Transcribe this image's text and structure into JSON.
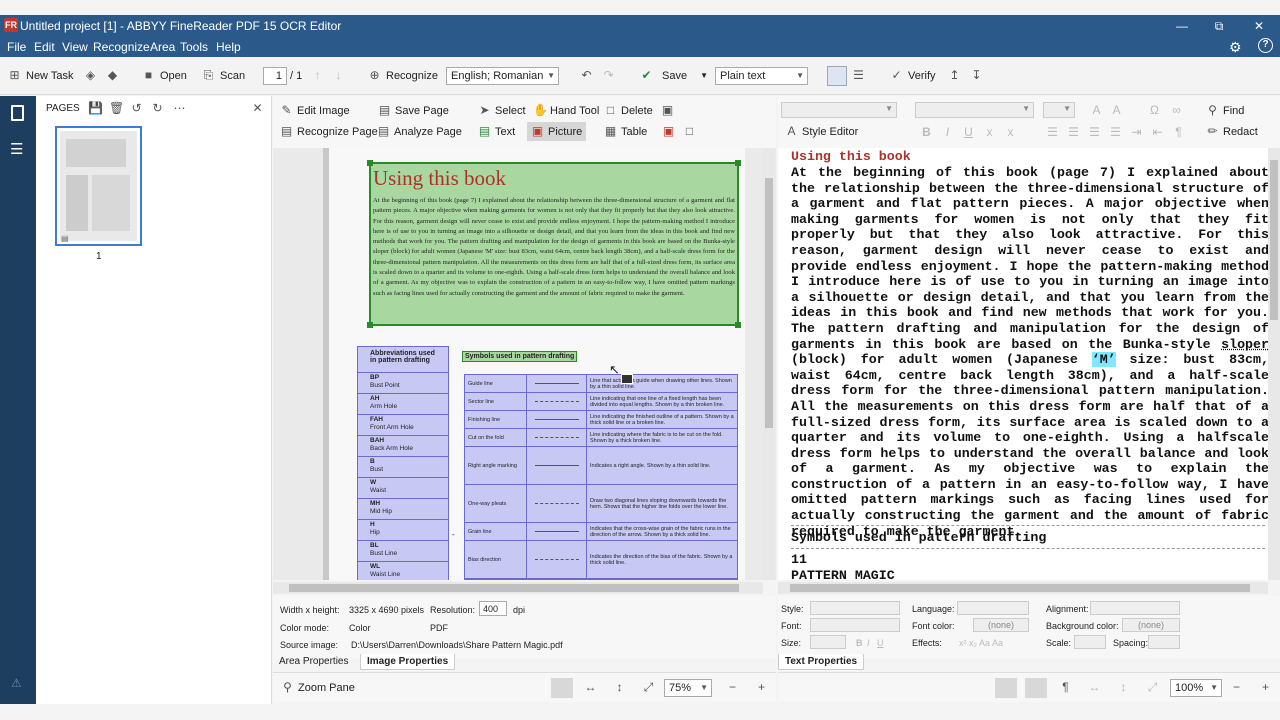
{
  "window": {
    "title": "Untitled project [1] - ABBYY FineReader PDF 15 OCR Editor",
    "app_icon": "FR"
  },
  "menu": [
    "File",
    "Edit",
    "View",
    "Recognize",
    "Area",
    "Tools",
    "Help"
  ],
  "toolbar": {
    "new_task": "New Task",
    "open": "Open",
    "scan": "Scan",
    "page_value": "1",
    "page_total": "/ 1",
    "recognize": "Recognize",
    "language": "English; Romanian",
    "save": "Save",
    "format": "Plain text",
    "verify": "Verify"
  },
  "pages_panel": {
    "title": "PAGES",
    "thumb_number": "1"
  },
  "image_tools": {
    "edit_image": "Edit Image",
    "save_page": "Save Page",
    "select": "Select",
    "hand_tool": "Hand Tool",
    "delete": "Delete",
    "recognize_page": "Recognize Page",
    "analyze_page": "Analyze Page",
    "text": "Text",
    "picture": "Picture",
    "table": "Table"
  },
  "document": {
    "heading": "Using this book",
    "body": "At the beginning of this book (page 7) I explained about the relationship between the three-dimensional structure of a garment and flat pattern pieces. A major objective when making garments for women is not only that they fit properly but that they also look attractive. For this reason, garment design will never cease to exist and provide endless enjoyment. I hope the pattern-making method I introduce here is of use to you in turning an image into a silhouette or design detail, and that you learn from the ideas in this book and find new methods that work for you. The pattern drafting and manipulation for the design of garments in this book are based on the Bunka-style sloper (block) for adult women (Japanese 'M' size: bust 83cm, waist 64cm, centre back length 38cm), and a half-scale dress form for the three-dimensional pattern manipulation. All the measurements on this dress form are half that of a full-sized dress form, its surface area is scaled down to a quarter and its volume to one-eighth. Using a half-scale dress form helps to understand the overall balance and look of a garment. As my objective was to explain the construction of a pattern in an easy-to-follow way, I have omitted pattern markings such as facing lines used for actually constructing the garment and the amount of fabric required to make the garment.",
    "abbr_title": "Abbreviations used in pattern drafting",
    "abbr": [
      {
        "code": "BP",
        "name": "Bust Point"
      },
      {
        "code": "AH",
        "name": "Arm Hole"
      },
      {
        "code": "FAH",
        "name": "Front Arm Hole"
      },
      {
        "code": "BAH",
        "name": "Back Arm Hole"
      },
      {
        "code": "B",
        "name": "Bust"
      },
      {
        "code": "W",
        "name": "Waist"
      },
      {
        "code": "MH",
        "name": "Mid Hip"
      },
      {
        "code": "H",
        "name": "Hip"
      },
      {
        "code": "BL",
        "name": "Bust Line"
      },
      {
        "code": "WL",
        "name": "Waist Line"
      }
    ],
    "sym_title": "Symbols used in pattern drafting",
    "symbols": [
      {
        "name": "Guide line",
        "desc": "Line that acts as a guide when drawing other lines. Shown by a thin solid line."
      },
      {
        "name": "Sector line",
        "desc": "Line indicating that one line of a fixed length has been divided into equal lengths. Shown by a thin broken line."
      },
      {
        "name": "Finishing line",
        "desc": "Line indicating the finished outline of a pattern. Shown by a thick solid line or a broken line."
      },
      {
        "name": "Cut on the fold",
        "desc": "Line indicating where the fabric is to be cut on the fold. Shown by a thick broken line."
      },
      {
        "name": "Right angle marking",
        "desc": "Indicates a right angle. Shown by a thin solid line."
      },
      {
        "name": "One-way pleats",
        "desc": "Draw two diagonal lines sloping downwards towards the hem. Shows that the higher line folds over the lower line."
      },
      {
        "name": "Grain line",
        "desc": "Indicates that the cross-wise grain of the fabric runs in the direction of the arrow. Shown by a thick solid line."
      },
      {
        "name": "Bias direction",
        "desc": "Indicates the direction of the bias of the fabric. Shown by a thick solid line."
      }
    ]
  },
  "image_props": {
    "wh_label": "Width x height:",
    "wh_value": "3325 x 4690 pixels",
    "res_label": "Resolution:",
    "res_value": "400",
    "res_unit": "dpi",
    "color_label": "Color mode:",
    "color_value": "Color",
    "format_value": "PDF",
    "source_label": "Source image:",
    "source_value": "D:\\Users\\Darren\\Downloads\\Share Pattern Magic.pdf"
  },
  "left_tabs": [
    "Area Properties",
    "Image Properties"
  ],
  "left_bottom": {
    "zoom_pane": "Zoom Pane",
    "zoom": "75%"
  },
  "right_tools": {
    "style_editor": "Style Editor",
    "find": "Find",
    "redact": "Redact"
  },
  "text_pane": {
    "heading": "Using this book",
    "para_before": "At the beginning of this book (page 7) I explained about the relationship between the three-dimensional structure of a garment and flat pattern pieces. A major objective when making garments for women is not only that they fit properly but that they also look attractive. For this reason, garment design will never cease to exist and provide endless enjoyment. I hope the pattern-making method I introduce here is of use to you in turning an image into a silhouette or design detail, and that you learn from the ideas in this book and find new methods that work for you. The pattern drafting and manipulation for the design of garments in this book are based on the Bunka-style ",
    "sloper": "sloper",
    "para_mid": " (block) for adult women (Japanese ",
    "highlight": "‘M’",
    "para_after": " size: bust 83cm, waist 64cm, centre back length 38cm), and a half-scale dress form for the three-dimensional pattern manipulation. All the measurements on this dress form are half that of a full-sized dress form, its surface area is scaled down to a quarter and its volume to one-eighth. Using a halfscale dress form helps to understand the overall balance and look of a garment. As my objective was to explain the construction of a pattern in an easy-to-follow way, I have omitted pattern markings such as facing lines used for actually constructing the garment and the amount of fabric required to make the garment.",
    "symbols_line": "Symbols used in pattern drafting",
    "page_num": "11",
    "footer": "PATTERN MAGIC"
  },
  "text_props": {
    "style": "Style:",
    "font": "Font:",
    "size": "Size:",
    "language": "Language:",
    "font_color": "Font color:",
    "effects": "Effects:",
    "font_color_value": "(none)",
    "alignment": "Alignment:",
    "bg_color": "Background color:",
    "bg_color_value": "(none)",
    "scale": "Scale:",
    "spacing": "Spacing:"
  },
  "right_tabs": [
    "Text Properties"
  ],
  "right_bottom": {
    "zoom": "100%"
  },
  "colors": {
    "title_bar": "#2b5a8a",
    "nav": "#1d3e5e",
    "text_area": "#a8d8a0",
    "picture_area": "#c8c8f5",
    "heading_red": "#b0302a"
  }
}
